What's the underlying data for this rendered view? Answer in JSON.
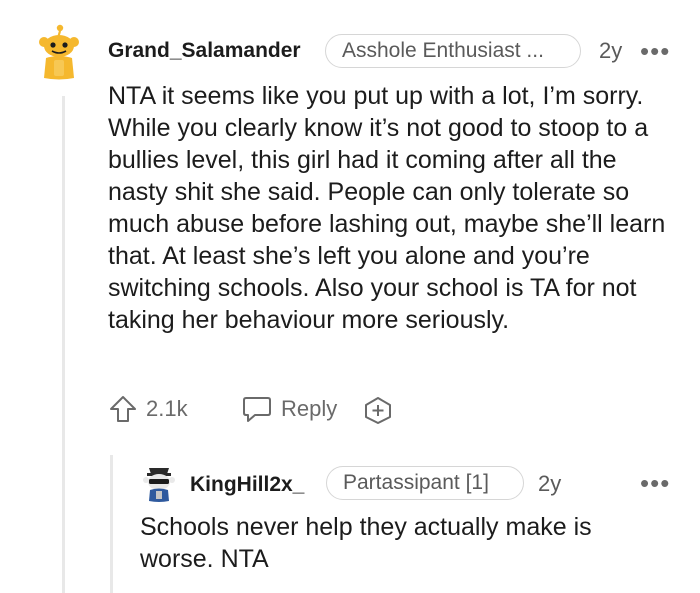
{
  "comment1": {
    "username": "Grand_Salamander",
    "flair": "Asshole Enthusiast ...",
    "age": "2y",
    "more": "•••",
    "text": "NTA it seems like you put up with a lot, I’m sorry. While you clearly know it’s not good to stoop to a bullies level, this girl had it coming after all the nasty shit she said. People can only tolerate so much abuse before lashing out, maybe she’ll learn that. At least she’s left you alone and you’re switching schools. Also your school is TA for not taking her behaviour more seriously.",
    "upvotes": "2.1k",
    "reply_label": "Reply",
    "icons": [
      "upvote-icon",
      "reply-icon",
      "award-icon",
      "snoo-avatar"
    ]
  },
  "comment2": {
    "username": "KingHill2x_",
    "flair": "Partassipant [1]",
    "age": "2y",
    "more": "•••",
    "text": "Schools never help they actually make is worse. NTA"
  },
  "colors": {
    "text": "#1c1c1c",
    "meta": "#5a5a5a",
    "avatar_orange": "#f5b82e",
    "border": "#d6d6d6"
  }
}
